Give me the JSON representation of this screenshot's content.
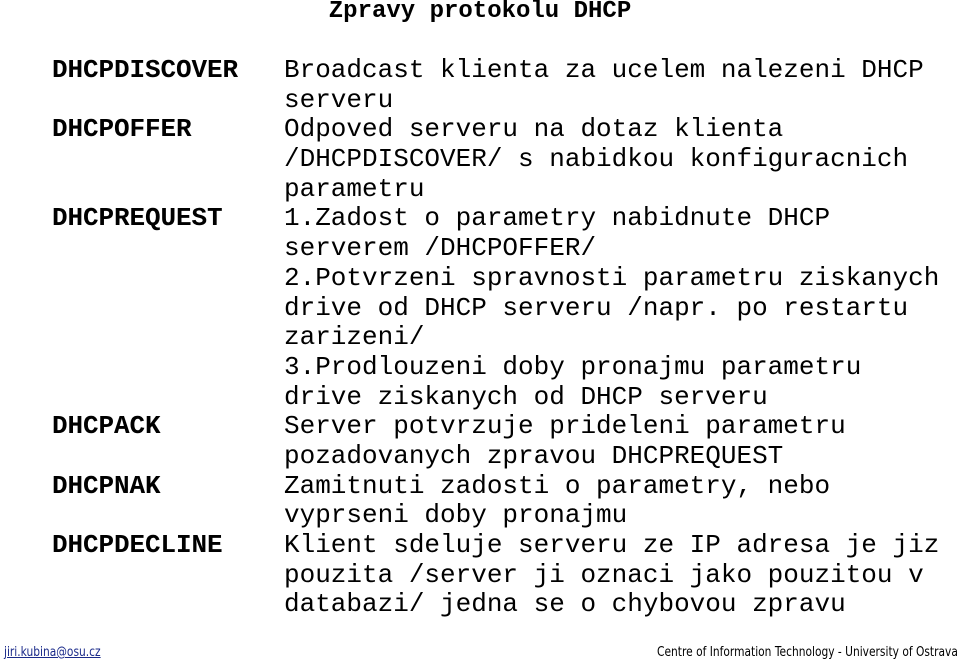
{
  "title": "Zpravy protokolu DHCP",
  "messages": [
    {
      "name": "DHCPDISCOVER",
      "lines": [
        "Broadcast klienta za ucelem nalezeni DHCP",
        "serveru"
      ]
    },
    {
      "name": "DHCPOFFER",
      "lines": [
        "Odpoved serveru na dotaz klienta",
        "/DHCPDISCOVER/ s nabidkou konfiguracnich",
        "parametru"
      ]
    },
    {
      "name": "DHCPREQUEST",
      "lines": [
        "1.Zadost o parametry nabidnute DHCP",
        "serverem /DHCPOFFER/",
        "2.Potvrzeni spravnosti parametru ziskanych",
        "drive od DHCP serveru /napr. po restartu",
        "zarizeni/",
        "3.Prodlouzeni doby pronajmu parametru",
        "drive ziskanych od DHCP serveru"
      ]
    },
    {
      "name": "DHCPACK",
      "lines": [
        "Server potvrzuje prideleni parametru",
        "pozadovanych zpravou DHCPREQUEST"
      ]
    },
    {
      "name": "DHCPNAK",
      "lines": [
        "Zamitnuti zadosti o parametry, nebo",
        "vyprseni doby pronajmu"
      ]
    },
    {
      "name": "DHCPDECLINE",
      "lines": [
        "Klient sdeluje serveru ze IP adresa je jiz",
        "pouzita /server ji oznaci jako pouzitou v",
        "databazi/ jedna se o chybovou zpravu"
      ]
    }
  ],
  "footer": {
    "email": "jiri.kubina@osu.cz",
    "institution": "Centre of Information Technology - University of Ostrava"
  },
  "colors": {
    "text": "#000000",
    "link": "#1a2a8a",
    "background": "#ffffff"
  }
}
